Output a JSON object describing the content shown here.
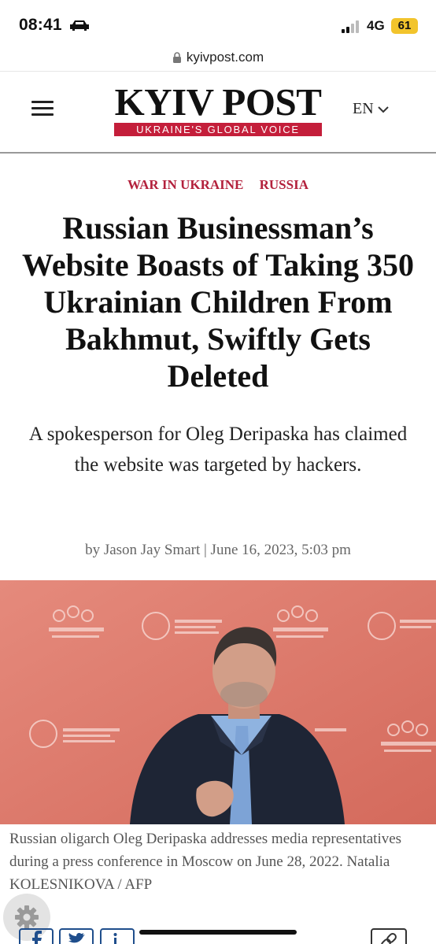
{
  "status_bar": {
    "time": "08:41",
    "network": "4G",
    "battery": "61"
  },
  "browser": {
    "url": "kyivpost.com"
  },
  "header": {
    "logo_title": "KYIV POST",
    "logo_tagline": "UKRAINE'S GLOBAL VOICE",
    "language": "EN"
  },
  "article": {
    "categories": [
      "WAR IN UKRAINE",
      "RUSSIA"
    ],
    "headline": "Russian Businessman’s Website Boasts of Taking 350 Ukrainian Children From Bakhmut, Swiftly Gets Deleted",
    "subheadline": "A spokesperson for Oleg Deripaska has claimed the website was targeted by hackers.",
    "byline": "by Jason Jay Smart | June 16, 2023, 5:03 pm",
    "photo_caption": "Russian oligarch Oleg Deripaska addresses media representatives during a press conference in Moscow on June 28, 2022. Natalia KOLESNIKOVA / AFP"
  },
  "colors": {
    "brand_red": "#c41e3a",
    "category_red": "#b3213c",
    "battery_yellow": "#f2c42c",
    "share_blue": "#1f4e8c"
  },
  "icons": [
    "car-icon",
    "signal-icon",
    "lock-icon",
    "menu-icon",
    "chevron-down-icon",
    "gear-icon",
    "facebook-icon",
    "twitter-icon",
    "linkedin-icon",
    "link-icon"
  ]
}
